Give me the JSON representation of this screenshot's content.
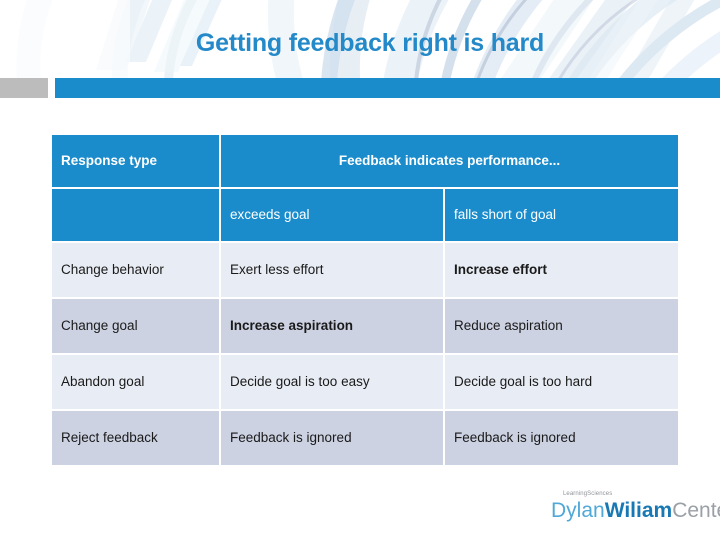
{
  "slide": {
    "title": "Getting feedback right is hard"
  },
  "table": {
    "header": {
      "response_type": "Response type",
      "feedback_indicates": "Feedback indicates performance..."
    },
    "subheader": {
      "blank": "",
      "exceeds": "exceeds goal",
      "falls_short": "falls short of goal"
    },
    "rows": [
      {
        "response": "Change behavior",
        "exceeds": "Exert less effort",
        "exceeds_bold": false,
        "falls_short": "Increase effort",
        "falls_short_bold": true,
        "shade": "light"
      },
      {
        "response": "Change goal",
        "exceeds": "Increase aspiration",
        "exceeds_bold": true,
        "falls_short": "Reduce aspiration",
        "falls_short_bold": false,
        "shade": "dark"
      },
      {
        "response": "Abandon goal",
        "exceeds": "Decide goal is too easy",
        "exceeds_bold": false,
        "falls_short": "Decide goal is too hard",
        "falls_short_bold": false,
        "shade": "light"
      },
      {
        "response": "Reject feedback",
        "exceeds": "Feedback is ignored",
        "exceeds_bold": false,
        "falls_short": "Feedback is ignored",
        "falls_short_bold": false,
        "shade": "dark"
      }
    ]
  },
  "logo": {
    "tagline_learning": "Learning",
    "tagline_sciences": "Sciences",
    "name_dylan": "Dylan",
    "name_wiliam": "Wiliam",
    "name_center": "Center"
  },
  "colors": {
    "accent_blue": "#1b8ccb",
    "title_blue": "#2389c8",
    "row_light": "#e8ecf4",
    "row_dark": "#ccd2e2",
    "rule_gray": "#bcbcbc"
  }
}
